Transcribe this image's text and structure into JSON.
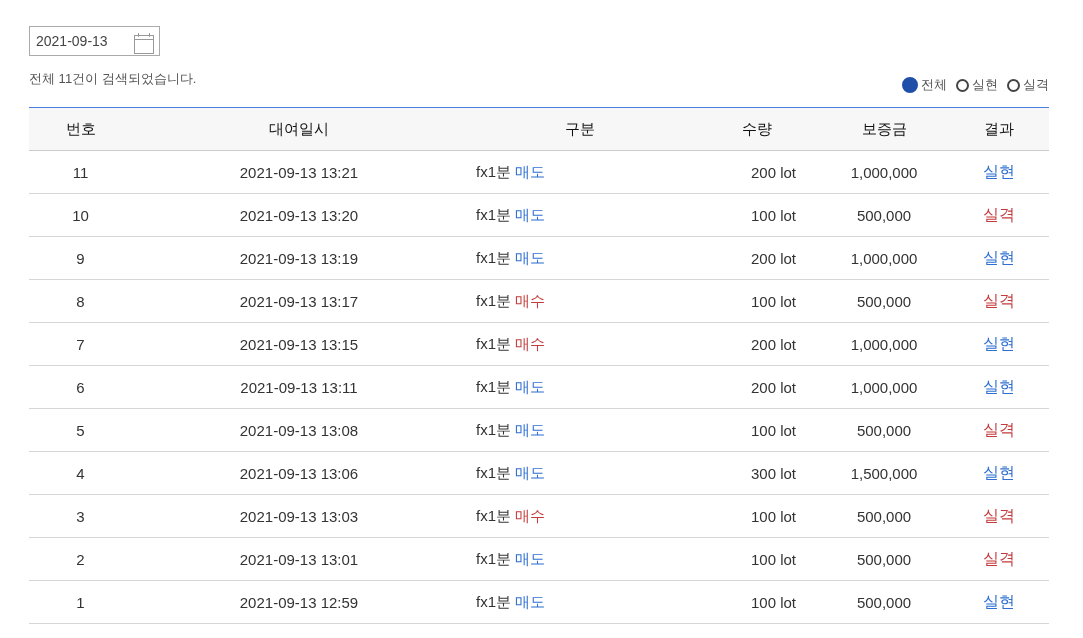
{
  "date_field": {
    "value": "2021-09-13"
  },
  "summary": "전체 11건이 검색되었습니다.",
  "filters": [
    {
      "label": "전체",
      "selected": true
    },
    {
      "label": "실현",
      "selected": false
    },
    {
      "label": "실격",
      "selected": false
    }
  ],
  "table": {
    "columns": [
      "번호",
      "대여일시",
      "구분",
      "수량",
      "보증금",
      "결과"
    ],
    "rows": [
      {
        "no": "11",
        "time": "2021-09-13 13:21",
        "product": "fx1분",
        "side": {
          "text": "매도",
          "color": "#2f6fd1"
        },
        "qty": "200 lot",
        "deposit": "1,000,000",
        "result": {
          "text": "실현",
          "color": "#2f6fd1"
        }
      },
      {
        "no": "10",
        "time": "2021-09-13 13:20",
        "product": "fx1분",
        "side": {
          "text": "매도",
          "color": "#2f6fd1"
        },
        "qty": "100 lot",
        "deposit": "500,000",
        "result": {
          "text": "실격",
          "color": "#c43c3c"
        }
      },
      {
        "no": "9",
        "time": "2021-09-13 13:19",
        "product": "fx1분",
        "side": {
          "text": "매도",
          "color": "#2f6fd1"
        },
        "qty": "200 lot",
        "deposit": "1,000,000",
        "result": {
          "text": "실현",
          "color": "#2f6fd1"
        }
      },
      {
        "no": "8",
        "time": "2021-09-13 13:17",
        "product": "fx1분",
        "side": {
          "text": "매수",
          "color": "#c43c3c"
        },
        "qty": "100 lot",
        "deposit": "500,000",
        "result": {
          "text": "실격",
          "color": "#c43c3c"
        }
      },
      {
        "no": "7",
        "time": "2021-09-13 13:15",
        "product": "fx1분",
        "side": {
          "text": "매수",
          "color": "#c43c3c"
        },
        "qty": "200 lot",
        "deposit": "1,000,000",
        "result": {
          "text": "실현",
          "color": "#2f6fd1"
        }
      },
      {
        "no": "6",
        "time": "2021-09-13 13:11",
        "product": "fx1분",
        "side": {
          "text": "매도",
          "color": "#2f6fd1"
        },
        "qty": "200 lot",
        "deposit": "1,000,000",
        "result": {
          "text": "실현",
          "color": "#2f6fd1"
        }
      },
      {
        "no": "5",
        "time": "2021-09-13 13:08",
        "product": "fx1분",
        "side": {
          "text": "매도",
          "color": "#2f6fd1"
        },
        "qty": "100 lot",
        "deposit": "500,000",
        "result": {
          "text": "실격",
          "color": "#c43c3c"
        }
      },
      {
        "no": "4",
        "time": "2021-09-13 13:06",
        "product": "fx1분",
        "side": {
          "text": "매도",
          "color": "#2f6fd1"
        },
        "qty": "300 lot",
        "deposit": "1,500,000",
        "result": {
          "text": "실현",
          "color": "#2f6fd1"
        }
      },
      {
        "no": "3",
        "time": "2021-09-13 13:03",
        "product": "fx1분",
        "side": {
          "text": "매수",
          "color": "#c43c3c"
        },
        "qty": "100 lot",
        "deposit": "500,000",
        "result": {
          "text": "실격",
          "color": "#c43c3c"
        }
      },
      {
        "no": "2",
        "time": "2021-09-13 13:01",
        "product": "fx1분",
        "side": {
          "text": "매도",
          "color": "#2f6fd1"
        },
        "qty": "100 lot",
        "deposit": "500,000",
        "result": {
          "text": "실격",
          "color": "#c43c3c"
        }
      },
      {
        "no": "1",
        "time": "2021-09-13 12:59",
        "product": "fx1분",
        "side": {
          "text": "매도",
          "color": "#2f6fd1"
        },
        "qty": "100 lot",
        "deposit": "500,000",
        "result": {
          "text": "실현",
          "color": "#2f6fd1"
        }
      }
    ]
  }
}
